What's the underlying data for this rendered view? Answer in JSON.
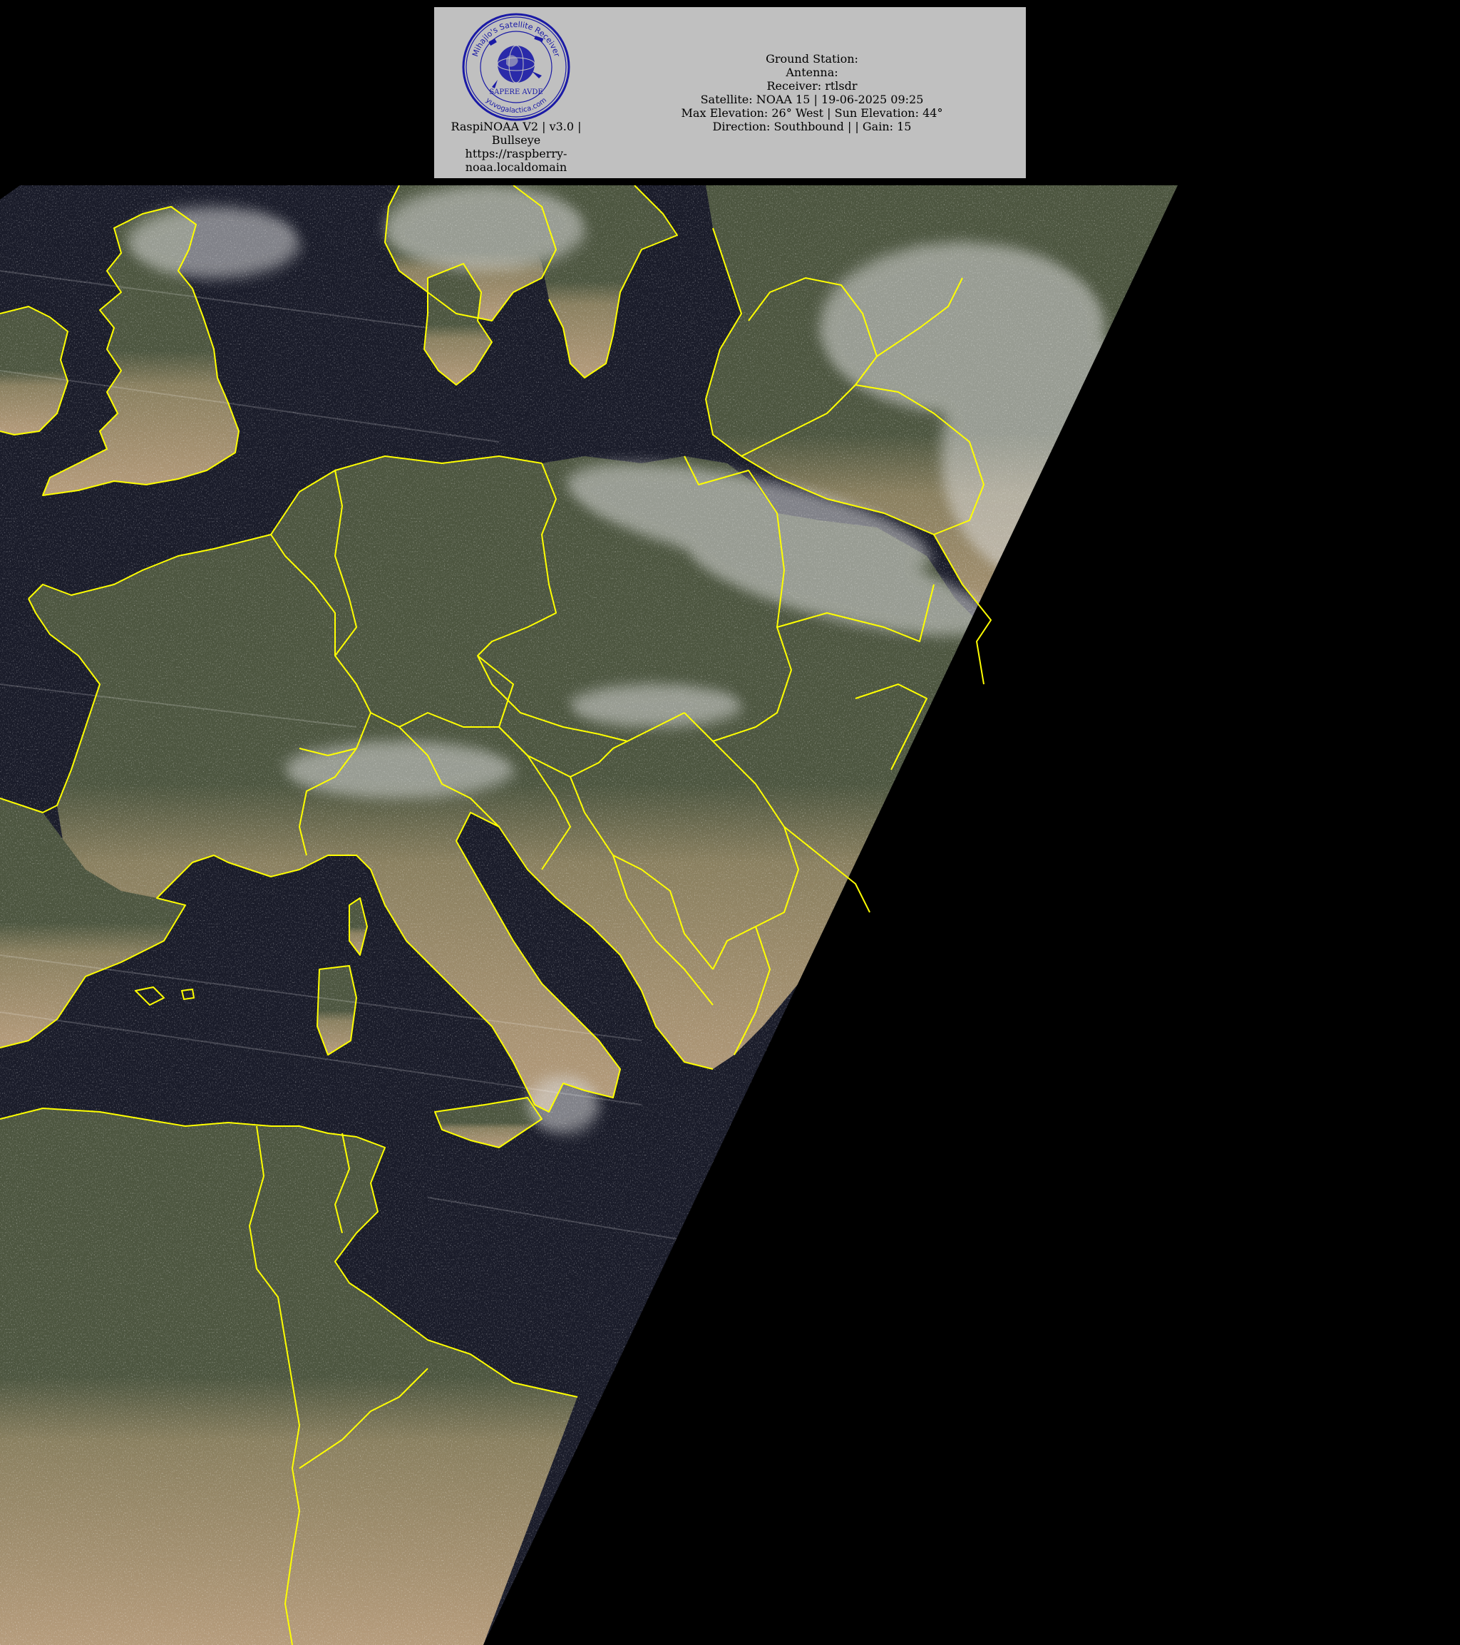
{
  "header": {
    "logo": {
      "icon": "satellite-receiver-seal-icon",
      "seal_text_top": "Mihajlo's Satellite Receiver",
      "seal_text_bottom": "yuvogalactica.com",
      "seal_motto": "SAPERE AVDE",
      "ink_color": "#1a1aa6"
    },
    "software": {
      "line1": "RaspiNOAA V2 | v3.0 |",
      "line2": "Bullseye",
      "line3": "https://raspberry-",
      "line4": "noaa.localdomain"
    },
    "pass": {
      "ground_station": "Ground Station:",
      "antenna": "Antenna:",
      "receiver": "Receiver: rtlsdr",
      "satellite": "Satellite: NOAA 15 | 19-06-2025 09:25",
      "elevation": "Max Elevation: 26° West | Sun Elevation: 44°",
      "direction": "Direction: Southbound | | Gain: 15"
    }
  },
  "map": {
    "icon": "noaa-satellite-map-image",
    "border_color": "#ffff00",
    "colors": {
      "sea": "#1a1c2a",
      "land_north": "#4d5640",
      "land_south": "#b69c7c",
      "cloud": "#d8d8d8",
      "background": "#000000"
    }
  }
}
